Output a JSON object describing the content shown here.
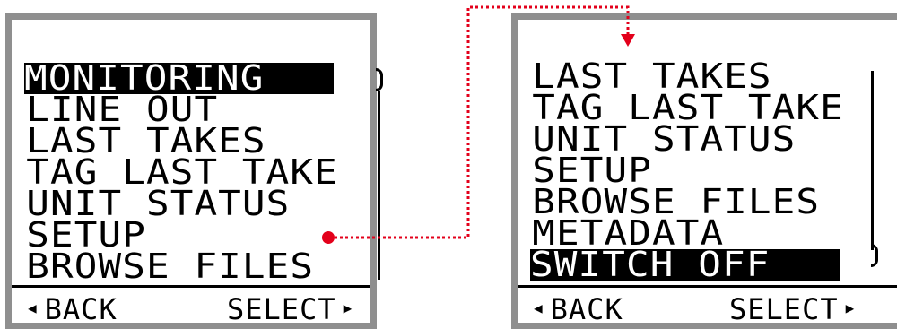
{
  "left_screen": {
    "menu_items": [
      "MONITORING",
      "LINE OUT",
      "LAST TAKES",
      "TAG LAST TAKE",
      "UNIT STATUS",
      "SETUP",
      "BROWSE FILES"
    ],
    "selected_index": 0,
    "back_label": "BACK",
    "select_label": "SELECT",
    "back_arrow": "◀",
    "select_arrow": "▶"
  },
  "right_screen": {
    "menu_items": [
      "LAST TAKES",
      "TAG LAST TAKE",
      "UNIT STATUS",
      "SETUP",
      "BROWSE FILES",
      "METADATA",
      "SWITCH OFF"
    ],
    "selected_index": 6,
    "back_label": "BACK",
    "select_label": "SELECT",
    "back_arrow": "◀",
    "select_arrow": "▶"
  },
  "colors": {
    "bezel": "#8f8f8f",
    "connector": "#e3001b",
    "highlight": "#000000",
    "text": "#000000",
    "background": "#ffffff"
  }
}
